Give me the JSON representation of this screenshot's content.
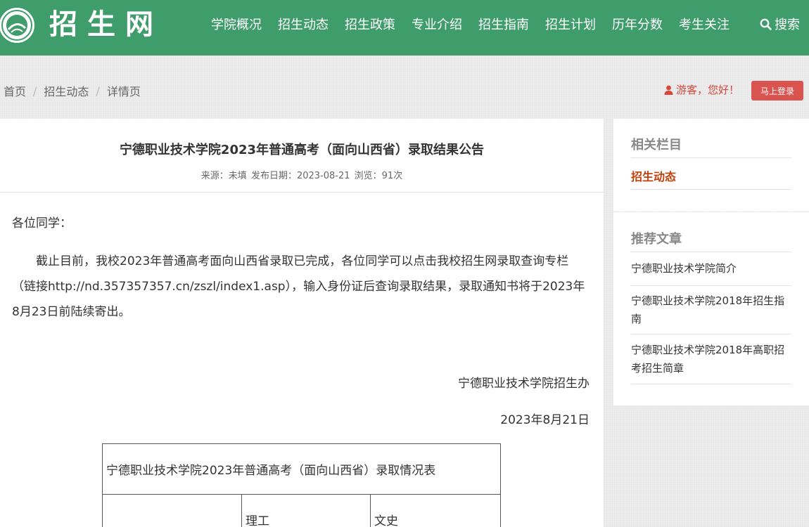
{
  "header": {
    "logo_text": "招生网",
    "nav": [
      "学院概况",
      "招生动态",
      "招生政策",
      "专业介绍",
      "招生指南",
      "招生计划",
      "历年分数",
      "考生关注"
    ],
    "search_label": "搜索"
  },
  "breadcrumb": {
    "items": [
      "首页",
      "招生动态",
      "详情页"
    ],
    "separator": "/"
  },
  "user": {
    "greeting": "游客，您好！",
    "login_label": "马上登录"
  },
  "article": {
    "title": "宁德职业技术学院2023年普通高考（面向山西省）录取结果公告",
    "meta_source": "来源：未填",
    "meta_date": "发布日期：2023-08-21",
    "meta_views": "浏览：91次",
    "greeting": "各位同学：",
    "paragraph": "截止目前，我校2023年普通高考面向山西省录取已完成，各位同学可以点击我校招生网录取查询专栏（链接http://nd.357357357.cn/zszl/index1.asp），输入身份证后查询录取结果，录取通知书将于2023年8月23日前陆续寄出。",
    "signature": "宁德职业技术学院招生办",
    "date": "2023年8月21日",
    "table": {
      "caption": "宁德职业技术学院2023年普通高考（面向山西省）录取情况表",
      "headers": [
        "",
        "理工",
        "文史"
      ]
    }
  },
  "sidebar": {
    "related_title": "相关栏目",
    "related_active": "招生动态",
    "recommend_title": "推荐文章",
    "recommend_items": [
      "宁德职业技术学院简介",
      "宁德职业技术学院2018年招生指南",
      "宁德职业技术学院2018年高职招考招生简章"
    ]
  },
  "colors": {
    "header_bg": "#3f9c6b",
    "accent_red": "#d9534f",
    "active_link": "#c2410c"
  }
}
